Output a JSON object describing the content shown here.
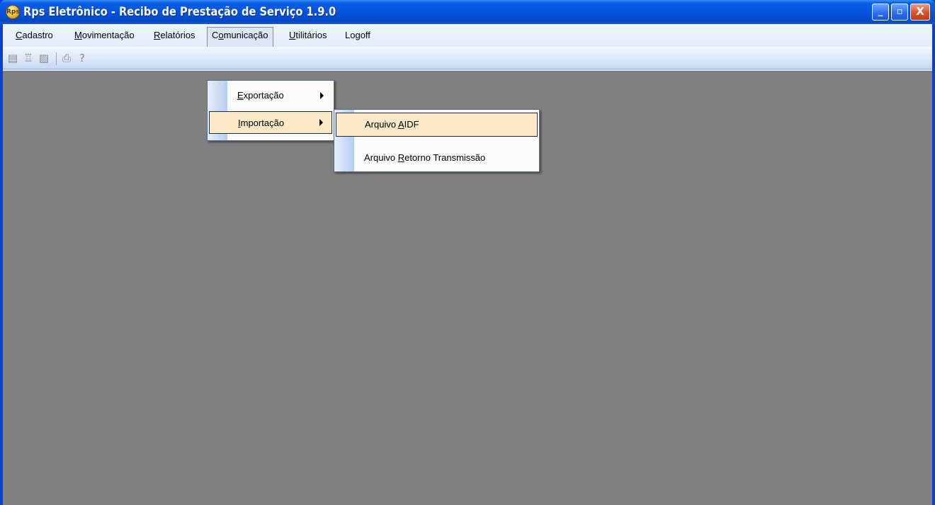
{
  "window": {
    "title": "Rps Eletrônico - Recibo de Prestação de Serviço 1.9.0",
    "app_icon": "app-logo-icon",
    "controls": {
      "minimize": "_",
      "maximize": "▫",
      "close": "X"
    }
  },
  "menubar": {
    "items": [
      {
        "accel": "C",
        "rest": "adastro",
        "name": "cadastro"
      },
      {
        "accel": "M",
        "rest": "ovimentação",
        "name": "movimentacao"
      },
      {
        "accel": "R",
        "rest": "elatórios",
        "name": "relatorios"
      },
      {
        "pre": "C",
        "accel": "o",
        "rest": "municação",
        "name": "comunicacao",
        "active": true
      },
      {
        "accel": "U",
        "rest": "tilitários",
        "name": "utilitarios"
      },
      {
        "accel": "",
        "rest": "Logoff",
        "name": "logoff"
      }
    ]
  },
  "toolbar": {
    "icons": [
      "save-icon",
      "cancel-icon",
      "edit-icon",
      "print-icon",
      "help-icon"
    ]
  },
  "comunicacao_menu": {
    "items": [
      {
        "accel": "E",
        "rest": "xportação",
        "has_submenu": true
      },
      {
        "accel": "I",
        "rest": "mportação",
        "has_submenu": true,
        "highlighted": true
      }
    ]
  },
  "importacao_submenu": {
    "items": [
      {
        "pre": "Arquivo ",
        "accel": "A",
        "rest": "IDF",
        "highlighted": true
      },
      {
        "pre": "Arquivo ",
        "accel": "R",
        "rest": "etorno Transmissão"
      }
    ]
  },
  "colors": {
    "titlebar": "#0553dc",
    "client_background": "#808080",
    "highlight": "#fbe8c6"
  }
}
